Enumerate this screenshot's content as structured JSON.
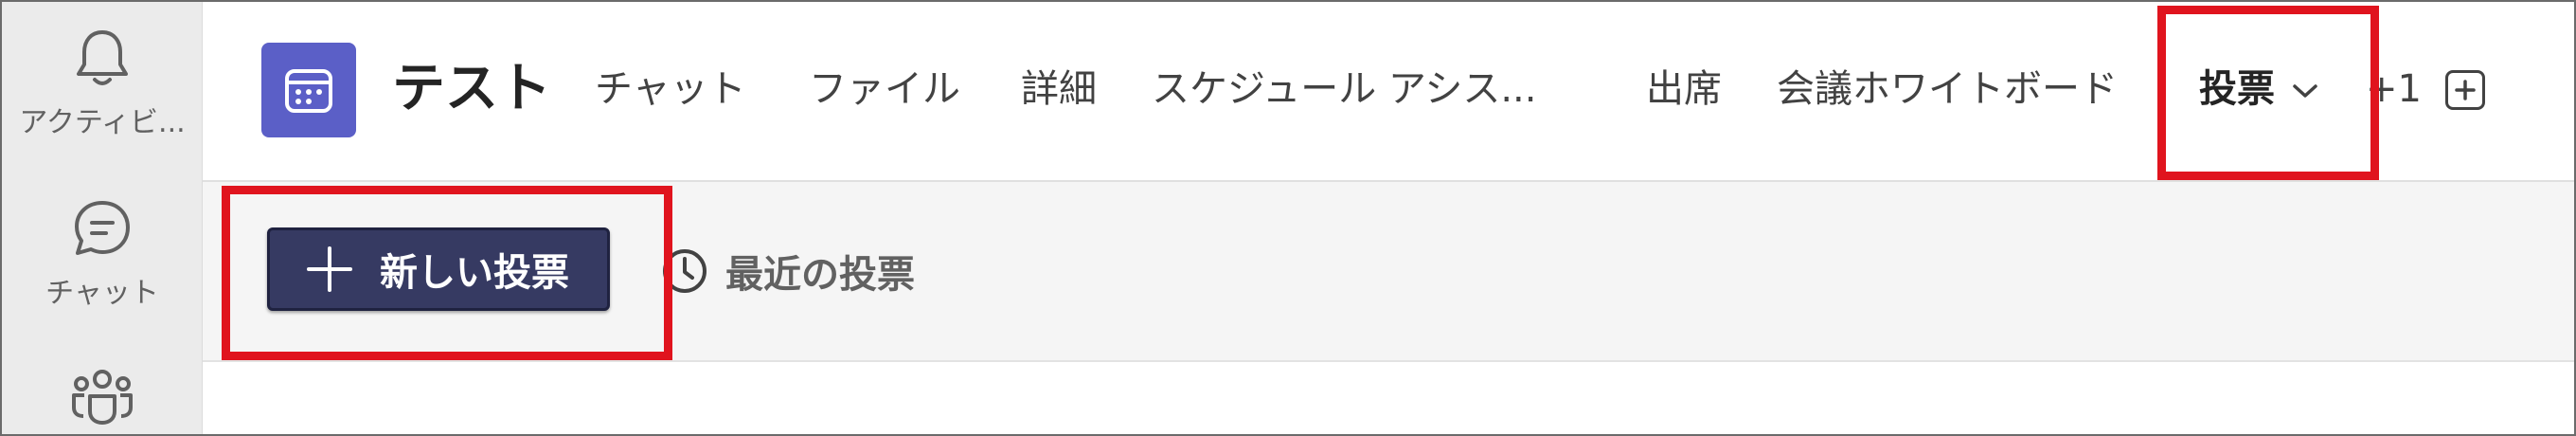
{
  "rail": {
    "items": [
      {
        "label": "アクティビ...",
        "icon": "bell-icon"
      },
      {
        "label": "チャット",
        "icon": "chat-icon"
      },
      {
        "label": "",
        "icon": "teams-icon"
      }
    ]
  },
  "header": {
    "title": "テスト",
    "tabs": [
      {
        "label": "チャット"
      },
      {
        "label": "ファイル"
      },
      {
        "label": "詳細"
      },
      {
        "label": "スケジュール アシス..."
      },
      {
        "label": "出席"
      },
      {
        "label": "会議ホワイトボード"
      },
      {
        "label": "投票",
        "active": true
      },
      {
        "label": "+1"
      }
    ]
  },
  "toolbar": {
    "new_poll_label": "新しい投票",
    "recent_polls_label": "最近の投票"
  },
  "colors": {
    "accent": "#5b5fc7",
    "primary_button": "#363a62",
    "highlight": "#e0141e"
  }
}
